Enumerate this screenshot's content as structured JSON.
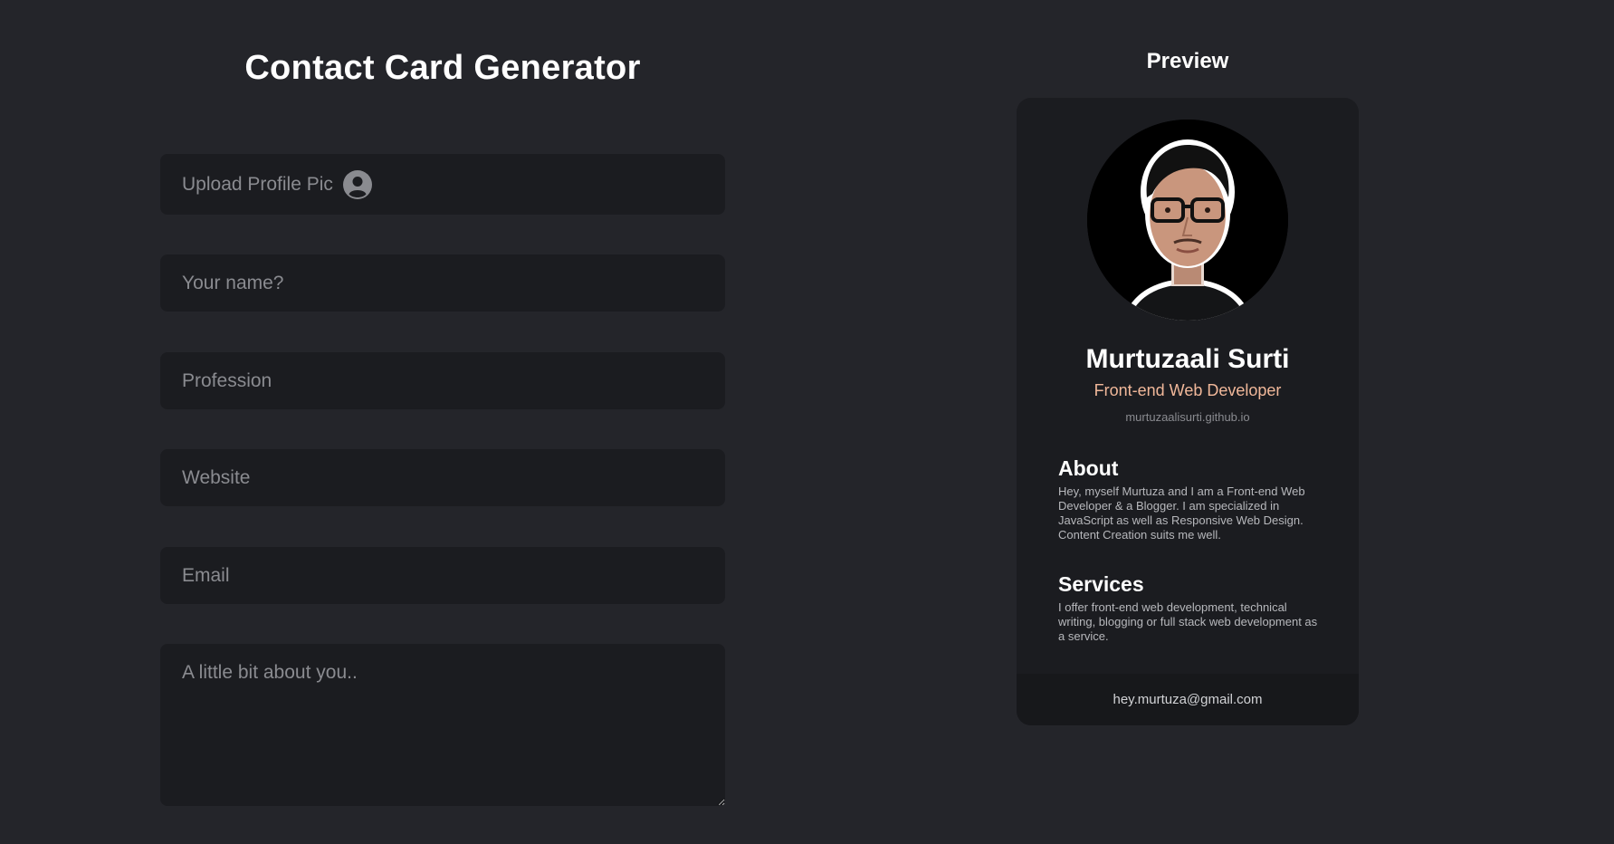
{
  "form": {
    "title": "Contact Card Generator",
    "upload_label": "Upload Profile Pic",
    "name_placeholder": "Your name?",
    "profession_placeholder": "Profession",
    "website_placeholder": "Website",
    "email_placeholder": "Email",
    "about_placeholder": "A little bit about you.."
  },
  "preview": {
    "title": "Preview",
    "name": "Murtuzaali Surti",
    "profession": "Front-end Web Developer",
    "website": "murtuzaalisurti.github.io",
    "about_title": "About",
    "about_text": "Hey, myself Murtuza and I am a Front-end Web Developer & a Blogger. I am specialized in JavaScript as well as Responsive Web Design. Content Creation suits me well.",
    "services_title": "Services",
    "services_text": "I offer front-end web development, technical writing, blogging or full stack web development as a service.",
    "email": "hey.murtuza@gmail.com"
  },
  "colors": {
    "background": "#24252a",
    "field_background": "#1b1c20",
    "profession_accent": "#f1b89a"
  },
  "icons": {
    "upload": "user-circle-icon"
  }
}
